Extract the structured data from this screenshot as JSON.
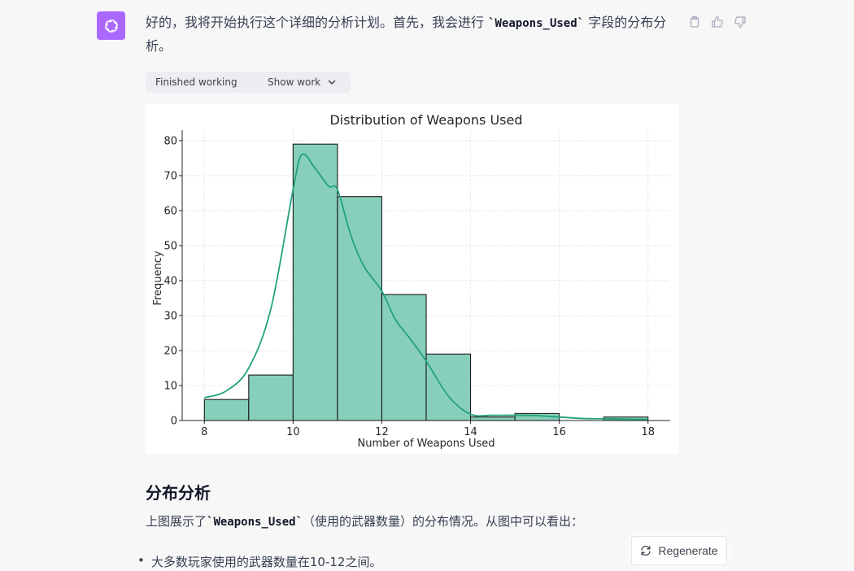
{
  "message": {
    "text_before_code": "好的，我将开始执行这个详细的分析计划。首先，我会进行 ",
    "code": "`Weapons_Used`",
    "text_after_code": " 字段的分布分析。"
  },
  "work_status": {
    "finished_label": "Finished working",
    "show_work_label": "Show work"
  },
  "chart_data": {
    "type": "bar",
    "title": "Distribution of Weapons Used",
    "xlabel": "Number of Weapons Used",
    "ylabel": "Frequency",
    "bins": [
      {
        "x0": 8,
        "x1": 9,
        "count": 6
      },
      {
        "x0": 9,
        "x1": 10,
        "count": 13
      },
      {
        "x0": 10,
        "x1": 11,
        "count": 79
      },
      {
        "x0": 11,
        "x1": 12,
        "count": 64
      },
      {
        "x0": 12,
        "x1": 13,
        "count": 36
      },
      {
        "x0": 13,
        "x1": 14,
        "count": 19
      },
      {
        "x0": 14,
        "x1": 15,
        "count": 1
      },
      {
        "x0": 15,
        "x1": 16,
        "count": 2
      },
      {
        "x0": 16,
        "x1": 17,
        "count": 0
      },
      {
        "x0": 17,
        "x1": 18,
        "count": 1
      }
    ],
    "kde": {
      "x": [
        8,
        8.5,
        9,
        9.5,
        10,
        10.2,
        10.5,
        10.8,
        11,
        11.3,
        11.6,
        12,
        12.3,
        12.6,
        13,
        13.5,
        14,
        14.5,
        15,
        15.5,
        16,
        16.5,
        17,
        17.5,
        18
      ],
      "y": [
        6.5,
        8.5,
        15,
        32,
        66,
        76,
        72,
        67,
        66,
        53,
        44,
        37,
        29,
        24,
        17,
        7,
        1.8,
        1.5,
        1.5,
        1.4,
        1.0,
        0.6,
        0.5,
        0.4,
        0.3
      ]
    },
    "xlim": [
      7.5,
      18.5
    ],
    "ylim": [
      0,
      83
    ],
    "xticks": [
      8,
      10,
      12,
      14,
      16,
      18
    ],
    "yticks": [
      0,
      10,
      20,
      30,
      40,
      50,
      60,
      70,
      80
    ],
    "bar_color": "#87cfbb",
    "bar_edge_color": "#1a1a1a",
    "kde_color": "#22a17d",
    "grid": true
  },
  "analysis": {
    "heading": "分布分析",
    "para_before_code": "上图展示了",
    "para_code": "`Weapons_Used`",
    "para_after_code": "（使用的武器数量）的分布情况。从图中可以看出：",
    "bullet": "大多数玩家使用的武器数量在10-12之间。"
  },
  "regenerate_label": "Regenerate"
}
